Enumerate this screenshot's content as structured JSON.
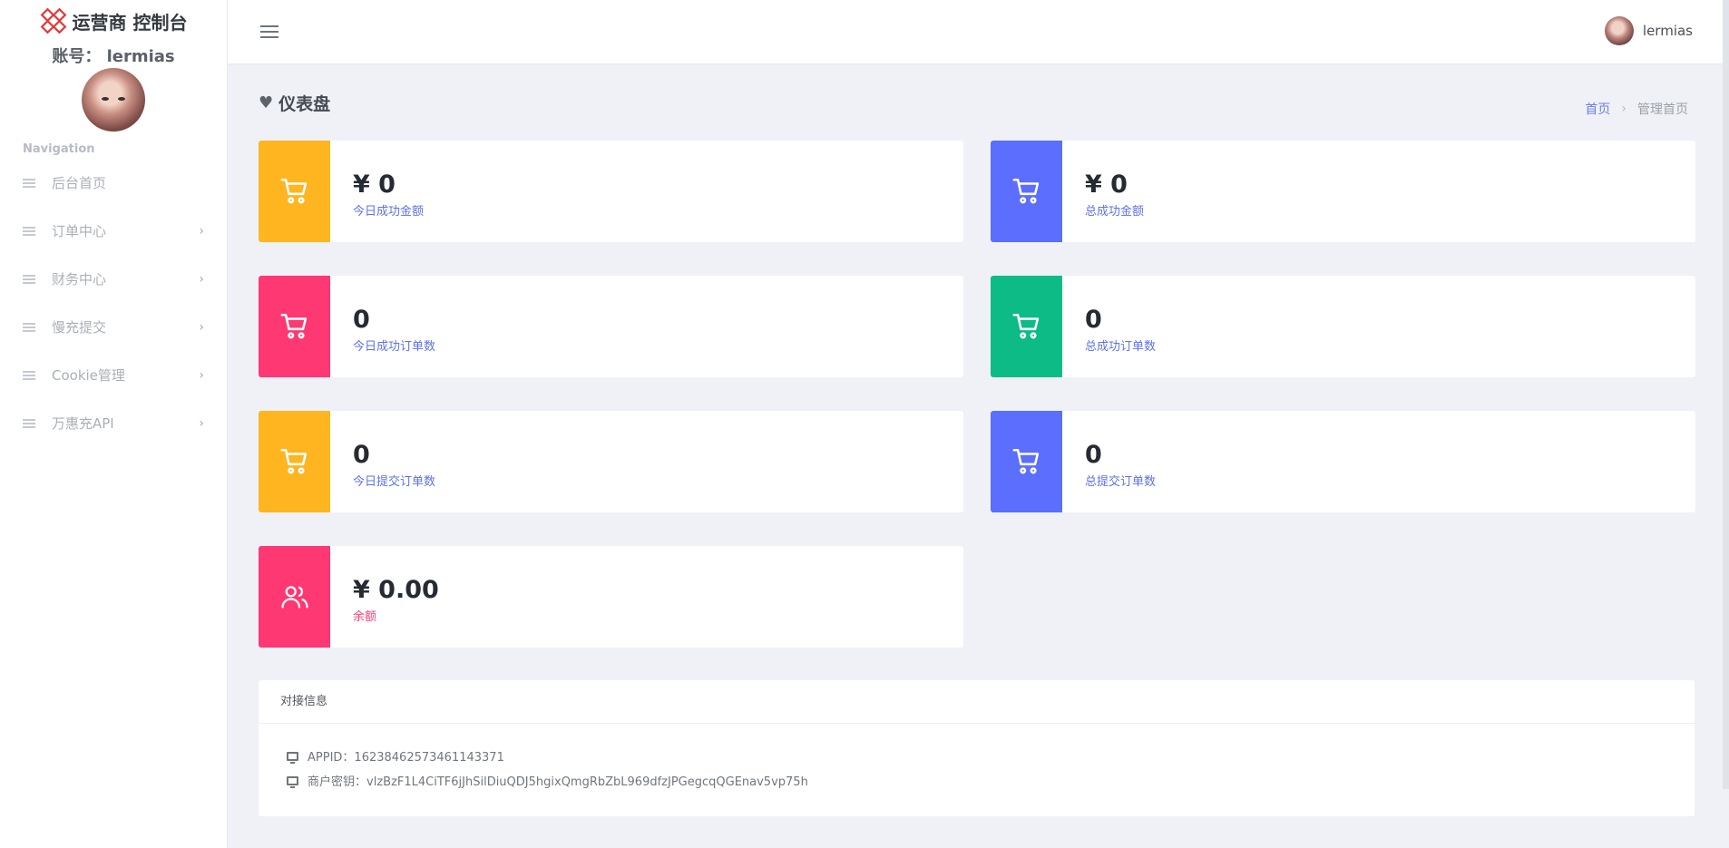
{
  "brand": {
    "title": "运营商 控制台"
  },
  "account": {
    "text": "账号： lermias"
  },
  "nav": {
    "title": "Navigation",
    "items": [
      {
        "label": "后台首页",
        "has_children": false
      },
      {
        "label": "订单中心",
        "has_children": true
      },
      {
        "label": "财务中心",
        "has_children": true
      },
      {
        "label": "慢充提交",
        "has_children": true
      },
      {
        "label": "Cookie管理",
        "has_children": true
      },
      {
        "label": "万惠充API",
        "has_children": true
      }
    ]
  },
  "topbar": {
    "username": "lermias"
  },
  "page": {
    "title": "仪表盘",
    "breadcrumb": {
      "home": "首页",
      "current": "管理首页"
    }
  },
  "cards": [
    {
      "value": "¥ 0",
      "label": "今日成功金额",
      "color": "#feb520",
      "icon": "cart-icon"
    },
    {
      "value": "¥ 0",
      "label": "总成功金额",
      "color": "#5b6efd",
      "icon": "cart-icon"
    },
    {
      "value": "0",
      "label": "今日成功订单数",
      "color": "#fd3873",
      "icon": "cart-icon"
    },
    {
      "value": "0",
      "label": "总成功订单数",
      "color": "#0dbb86",
      "icon": "cart-icon"
    },
    {
      "value": "0",
      "label": "今日提交订单数",
      "color": "#feb520",
      "icon": "cart-icon"
    },
    {
      "value": "0",
      "label": "总提交订单数",
      "color": "#5b6efd",
      "icon": "cart-icon"
    },
    {
      "value": "¥ 0.00",
      "label": "余额",
      "color": "#fd3873",
      "icon": "users-icon"
    }
  ],
  "info": {
    "title": "对接信息",
    "appid_label": "APPID：",
    "appid": "16238462573461143371",
    "key_label": "商户密钥：",
    "key": "vlzBzF1L4CiTF6jJhSilDiuQDJ5hgixQmgRbZbL969dfzJPGegcqQGEnav5vp75h"
  }
}
